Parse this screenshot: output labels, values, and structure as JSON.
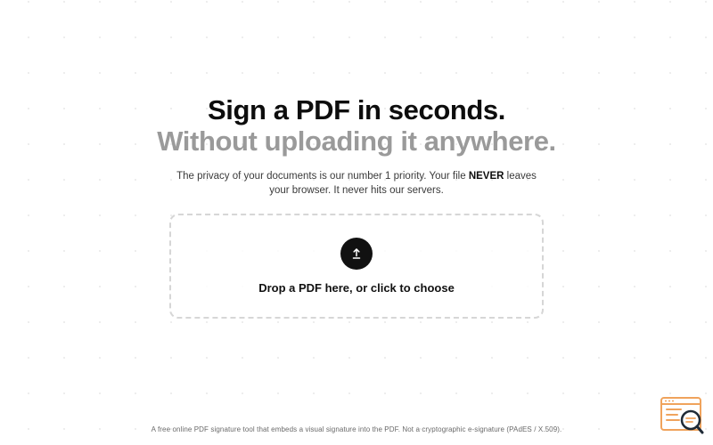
{
  "hero": {
    "title_line1": "Sign a PDF in seconds.",
    "title_line2": "Without uploading it anywhere.",
    "subtitle_part1": "The privacy of your documents is our number 1 priority. Your file ",
    "subtitle_emphasis": "NEVER",
    "subtitle_part2": " leaves your browser. It never hits our servers."
  },
  "dropzone": {
    "icon": "upload-arrow-icon",
    "label": "Drop a PDF here, or click to choose"
  },
  "footer": {
    "text": "A free online PDF signature tool that embeds a visual signature into the PDF. Not a cryptographic e-signature (PAdES / X.509)."
  },
  "widget": {
    "icon": "browser-search-icon",
    "accent_color": "#f0a35c",
    "dark_color": "#1f2a36"
  },
  "colors": {
    "title": "#0d0d0d",
    "title_muted": "#9a9a9a",
    "dropzone_border": "#d6d6d6",
    "button": "#111111"
  }
}
